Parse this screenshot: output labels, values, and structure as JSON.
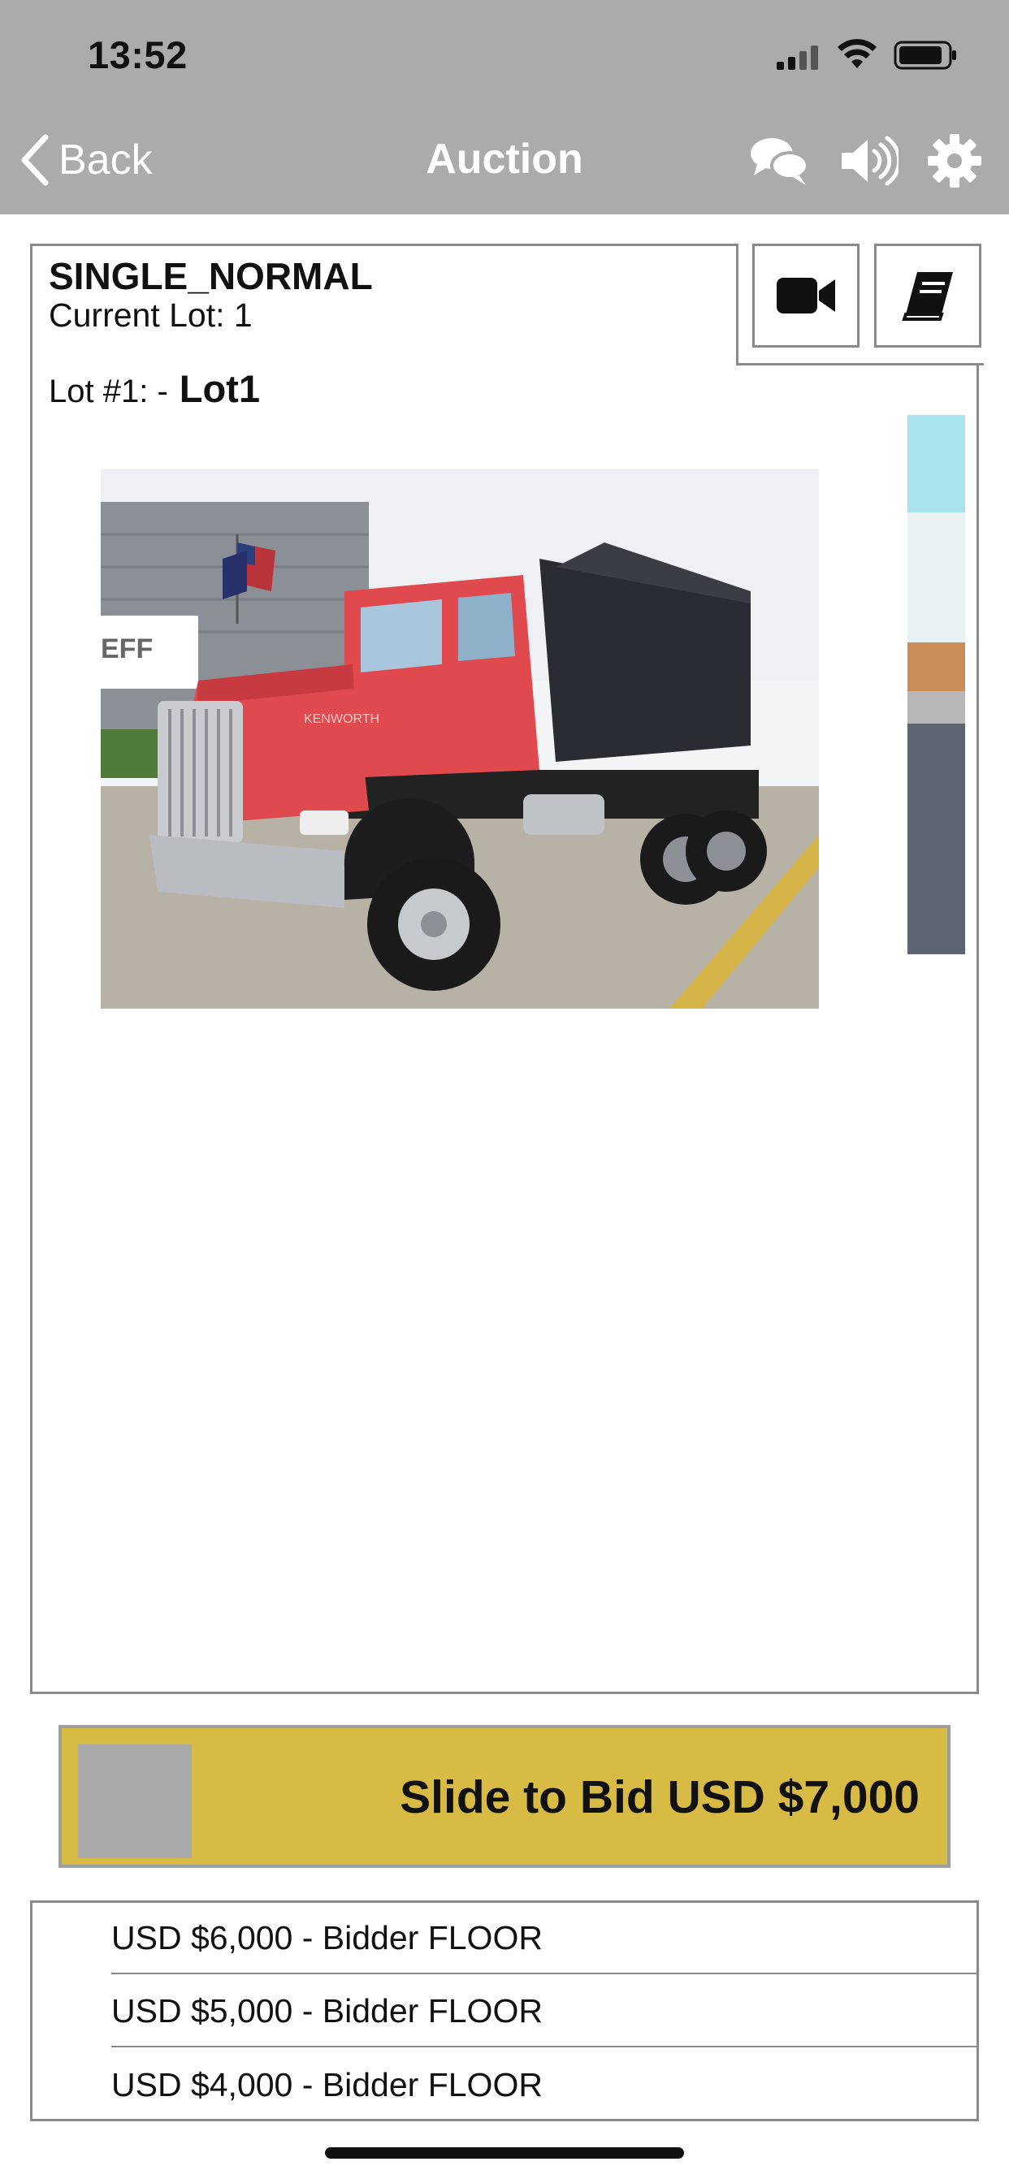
{
  "status_bar": {
    "time": "13:52"
  },
  "nav": {
    "back_label": "Back",
    "title": "Auction"
  },
  "lot": {
    "sale_name": "SINGLE_NORMAL",
    "current_lot_text": "Current Lot: 1",
    "lot_prefix": "Lot #1: -",
    "lot_name": "Lot1",
    "image_text": "KENWORTH"
  },
  "bid": {
    "slider_label": "Slide to Bid USD $7,000"
  },
  "bid_history": [
    {
      "text": "USD $6,000 - Bidder FLOOR"
    },
    {
      "text": "USD $5,000 - Bidder FLOOR"
    },
    {
      "text": "USD $4,000 - Bidder FLOOR"
    }
  ],
  "colors": {
    "topbar": "#ababab",
    "bid_slider": "#d7bb45",
    "slider_knob": "#a8a8a8",
    "truck_body": "#e04a4f"
  },
  "icons": {
    "chat": "chat-bubbles-icon",
    "sound": "volume-icon",
    "settings": "gear-icon",
    "video": "video-camera-icon",
    "catalog": "book-icon"
  }
}
